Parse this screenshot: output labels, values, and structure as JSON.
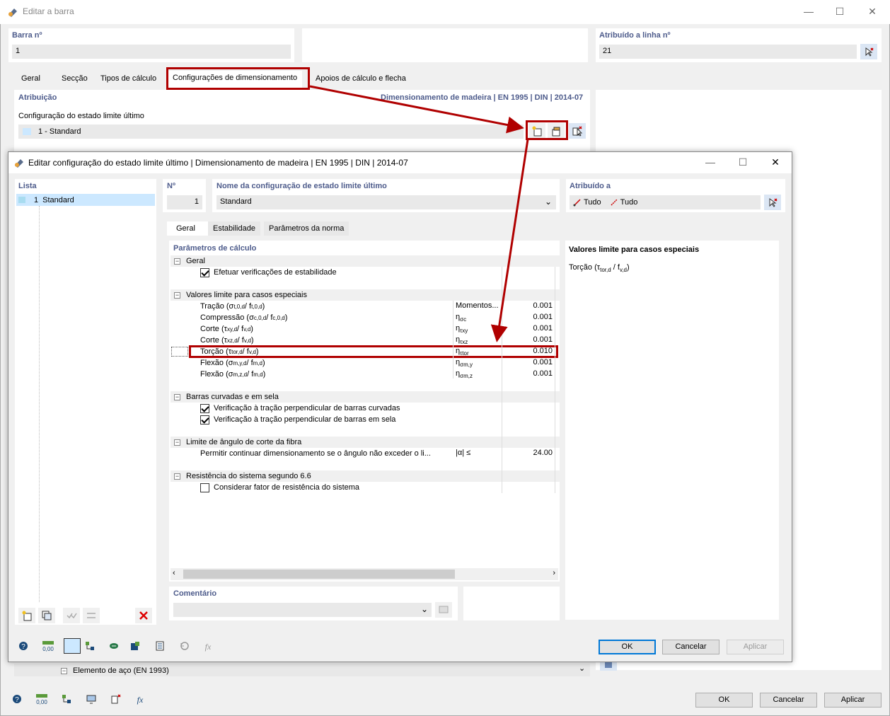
{
  "outer": {
    "title": "Editar a barra",
    "barra_label": "Barra nº",
    "barra_value": "1",
    "atrib_linha_label": "Atribuído a linha nº",
    "atrib_linha_value": "21",
    "tabs": [
      "Geral",
      "Secção",
      "Tipos de cálculo",
      "Configurações de dimensionamento",
      "Apoios de cálculo e flecha"
    ],
    "atribuicao_label": "Atribuição",
    "norm_label": "Dimensionamento de madeira | EN 1995 | DIN | 2014-07",
    "config_label": "Configuração do estado limite último",
    "config_value": "1 - Standard",
    "bottom_tree_item": "Elemento de aço (EN 1993)",
    "ok": "OK",
    "cancel": "Cancelar",
    "apply": "Aplicar"
  },
  "dialog": {
    "title": "Editar configuração do estado limite último | Dimensionamento de madeira | EN 1995 | DIN | 2014-07",
    "lista_label": "Lista",
    "list_items": [
      {
        "num": "1",
        "name": "Standard"
      }
    ],
    "no_label": "Nº",
    "no_value": "1",
    "name_label": "Nome da configuração de estado limite último",
    "name_value": "Standard",
    "atrib_label": "Atribuído a",
    "atrib_1": "Tudo",
    "atrib_2": "Tudo",
    "tabs": [
      "Geral",
      "Estabilidade",
      "Parâmetros da norma"
    ],
    "params_label": "Parâmetros de cálculo",
    "groups": {
      "geral": "Geral",
      "geral_item": "Efetuar verificações de estabilidade",
      "valores": "Valores limite para casos especiais",
      "barras": "Barras curvadas e em sela",
      "barras_1": "Verificação à tração perpendicular de barras curvadas",
      "barras_2": "Verificação à tração perpendicular de barras em sela",
      "limite": "Limite de ângulo de corte da fibra",
      "limite_item": "Permitir continuar dimensionamento se o ângulo não exceder o li...",
      "limite_sym": "|α| ≤",
      "limite_val": "24.00",
      "resist": "Resistência do sistema segundo 6.6",
      "resist_item": "Considerar fator de resistência do sistema"
    },
    "limit_rows": [
      {
        "name": "Tração (σ",
        "sub1": "t,0,d",
        "mid": " / f",
        "sub2": "t,0,d",
        "end": ")",
        "sym": "Momentos...",
        "symsub": "",
        "val": "0.001"
      },
      {
        "name": "Compressão (σ",
        "sub1": "c,0,d",
        "mid": " / f",
        "sub2": "c,0,d",
        "end": ")",
        "sym": "η",
        "symsub": "σc",
        "val": "0.001"
      },
      {
        "name": "Corte (τ",
        "sub1": "xy,d",
        "mid": " / f",
        "sub2": "v,d",
        "end": ")",
        "sym": "η",
        "symsub": "τxy",
        "val": "0.001"
      },
      {
        "name": "Corte (τ",
        "sub1": "xz,d",
        "mid": " / f",
        "sub2": "v,d",
        "end": ")",
        "sym": "η",
        "symsub": "τxz",
        "val": "0.001"
      },
      {
        "name": "Torção (τ",
        "sub1": "tor,d",
        "mid": " / f",
        "sub2": "v,d",
        "end": ")",
        "sym": "η",
        "symsub": "τtor",
        "val": "0.010"
      },
      {
        "name": "Flexão (σ",
        "sub1": "m,y,d",
        "mid": " / f",
        "sub2": "m,d",
        "end": ")",
        "sym": "η",
        "symsub": "σm,y",
        "val": "0.001"
      },
      {
        "name": "Flexão (σ",
        "sub1": "m,z,d",
        "mid": " / f",
        "sub2": "m,d",
        "end": ")",
        "sym": "η",
        "symsub": "σm,z",
        "val": "0.001"
      }
    ],
    "info_title": "Valores limite para casos especiais",
    "info_text": "Torção (τ",
    "info_sub1": "tor,d",
    "info_mid": " / f",
    "info_sub2": "v,d",
    "info_end": ")",
    "comentario_label": "Comentário",
    "ok": "OK",
    "cancel": "Cancelar",
    "apply": "Aplicar"
  },
  "colors": {
    "accent": "#0078d7",
    "highlight": "#b00000",
    "selection": "#cce8ff"
  }
}
